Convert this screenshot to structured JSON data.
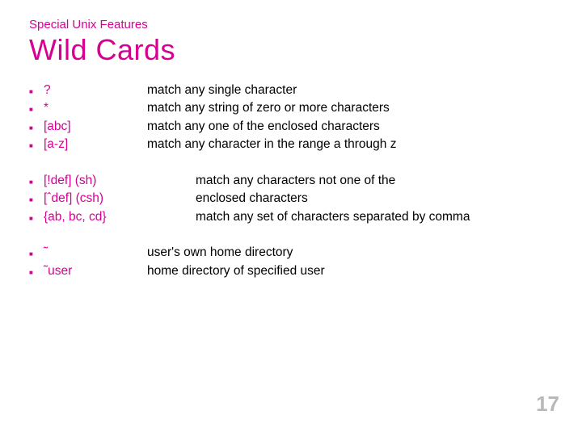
{
  "header": {
    "subtitle": "Special Unix Features",
    "title": "Wild Cards"
  },
  "group1": [
    {
      "term": "?",
      "desc": "match any single character"
    },
    {
      "term": "*",
      "desc": "match any string of zero or more characters"
    },
    {
      "term": "[abc]",
      "desc": "match any one of the enclosed characters"
    },
    {
      "term": "[a-z]",
      "desc": "match any character in the range a through z"
    }
  ],
  "group2": [
    {
      "term": "[!def] (sh)",
      "desc": "match any characters not one of the"
    },
    {
      "term": "[ˆdef] (csh)",
      "desc": "enclosed characters"
    },
    {
      "term": "{ab, bc, cd}",
      "desc": "match any set of characters  separated by comma"
    }
  ],
  "group3": [
    {
      "term": "˜",
      "desc": "user's own home directory"
    },
    {
      "term": "˜user",
      "desc": "home directory of specified user"
    }
  ],
  "page_number": "17"
}
